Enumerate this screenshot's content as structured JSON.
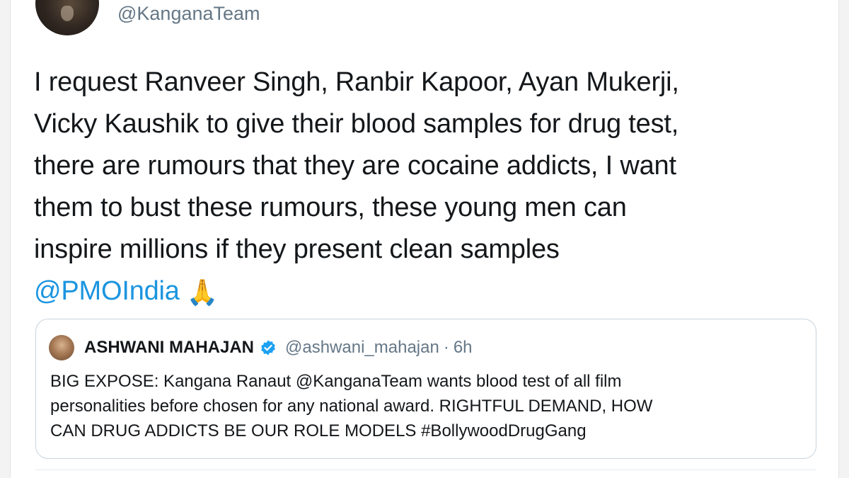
{
  "tweet": {
    "handle": "@KanganaTeam",
    "text_lines": [
      "I request Ranveer Singh, Ranbir Kapoor, Ayan Mukerji,",
      "Vicky Kaushik to give their blood samples for drug test,",
      "there are rumours that they are cocaine addicts, I want",
      "them to bust these rumours, these young men can",
      "inspire millions if they present clean samples"
    ],
    "mention": "@PMOIndia",
    "emoji": "🙏"
  },
  "quoted_tweet": {
    "name": "ASHWANI MAHAJAN",
    "handle": "@ashwani_mahajan",
    "separator": "·",
    "time": "6h",
    "text_lines": [
      "BIG EXPOSE: Kangana Ranaut @KanganaTeam wants blood test of all film",
      "personalities before chosen for any national award. RIGHTFUL DEMAND, HOW",
      "CAN DRUG ADDICTS BE OUR ROLE MODELS #BollywoodDrugGang"
    ]
  },
  "colors": {
    "link": "#1b95e0",
    "text": "#14171a",
    "secondary": "#657786",
    "border": "#c9d3dc",
    "verified": "#1da1f2"
  },
  "icons": [
    "verified-badge-icon",
    "folded-hands-emoji"
  ]
}
